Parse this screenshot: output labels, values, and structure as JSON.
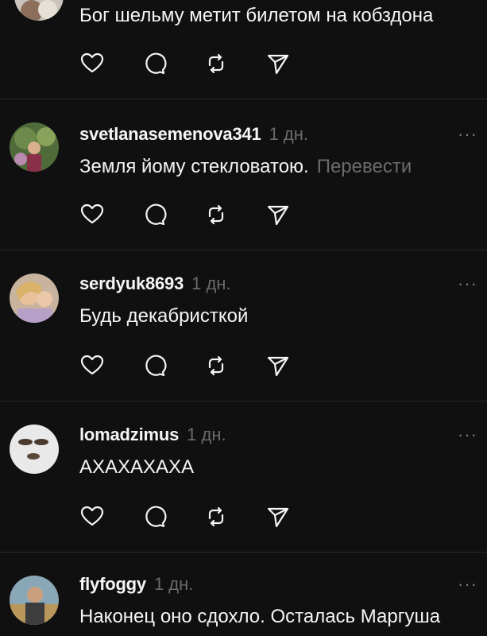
{
  "posts": [
    {
      "username": "",
      "time": "",
      "text": "Бог шельму метит билетом на кобздона",
      "translate": ""
    },
    {
      "username": "svetlanasemenova341",
      "time": "1 дн.",
      "text": "Земля йому стекловатою.",
      "translate": "Перевести"
    },
    {
      "username": "serdyuk8693",
      "time": "1 дн.",
      "text": "Будь декабристкой",
      "translate": ""
    },
    {
      "username": "lomadzimus",
      "time": "1 дн.",
      "text": "АХАХАХАХА",
      "translate": ""
    },
    {
      "username": "flyfoggy",
      "time": "1 дн.",
      "text": "Наконец оно сдохло. Осталась Маргуша",
      "translate": ""
    }
  ],
  "icons": {
    "like": "heart-icon",
    "reply": "comment-icon",
    "repost": "repost-icon",
    "share": "send-icon",
    "more": "more-icon"
  },
  "more_glyph": "···",
  "colors": {
    "background": "#101010",
    "text": "#f3f5f7",
    "muted": "#6b6b6b",
    "divider": "#2a2a2a"
  }
}
